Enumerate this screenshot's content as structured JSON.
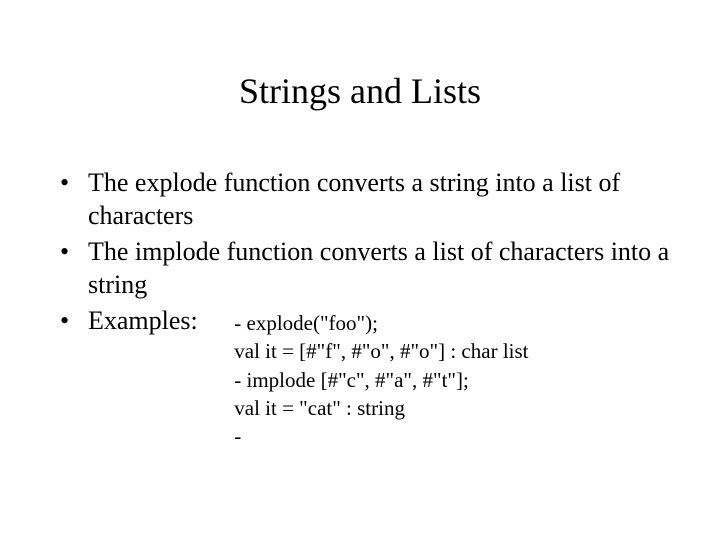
{
  "title": "Strings and Lists",
  "bullets": {
    "b1": "The explode function converts a string into a list of characters",
    "b2": "The implode function converts a list of characters into a string",
    "b3_label": "Examples:"
  },
  "code": {
    "l1": "- explode(\"foo\");",
    "l2": "val it = [#\"f\", #\"o\", #\"o\"] : char list",
    "l3": "- implode [#\"c\", #\"a\", #\"t\"];",
    "l4": "val it = \"cat\" : string",
    "l5": "-"
  }
}
